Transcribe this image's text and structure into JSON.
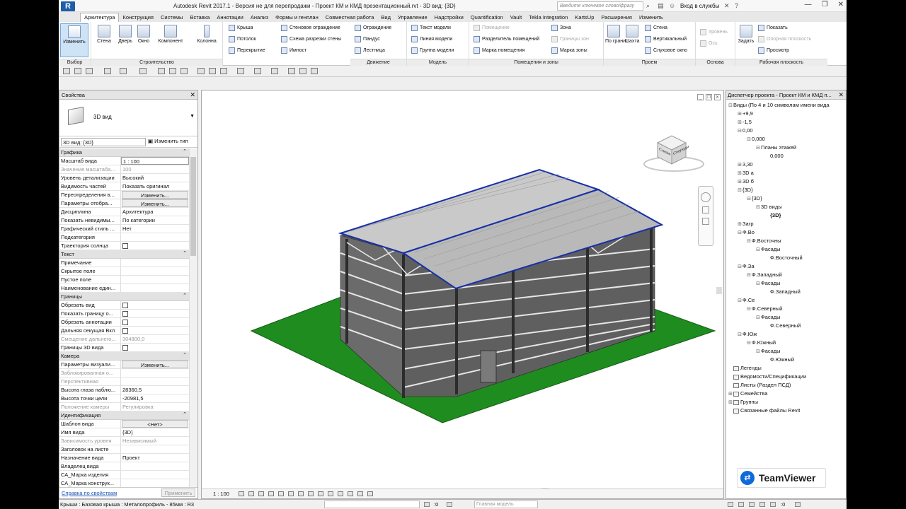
{
  "app": {
    "logo": "R",
    "title": "Autodesk Revit 2017.1 - Версия не для перепродажи -    Проект КМ и КМД презентационный.rvt - 3D вид: {3D}",
    "search_placeholder": "Введите ключевое слово/фразу",
    "login": "Вход в службы",
    "window_controls": [
      "—",
      "❐",
      "✕"
    ]
  },
  "ribbon_tabs": [
    "Архитектура",
    "Конструкция",
    "Системы",
    "Вставка",
    "Аннотации",
    "Анализ",
    "Формы и генплан",
    "Совместная работа",
    "Вид",
    "Управление",
    "Надстройки",
    "Quantification",
    "Vault",
    "Tekla Integration",
    "KartsUp",
    "Расширения",
    "Изменить"
  ],
  "ribbon": {
    "select_panel": "Выбор",
    "modify": "Изменить",
    "build_panel": "Строительство",
    "wall": "Стена",
    "door": "Дверь",
    "window": "Окно",
    "component": "Компонент",
    "column": "Колонна",
    "roof": "Крыша",
    "ceiling": "Потолок",
    "floor": "Перекрытие",
    "curtain_system": "Стеновое ограждение",
    "curtain_grid": "Схема разрезки стены",
    "mullion": "Импост",
    "circulation_panel": "Движение",
    "railing": "Ограждение",
    "ramp": "Пандус",
    "stair": "Лестница",
    "model_panel": "Модель",
    "model_text": "Текст модели",
    "model_line": "Линия модели",
    "model_group": "Группа модели",
    "rooms_panel": "Помещения и зоны",
    "room": "Помещение",
    "room_separator": "Разделитель помещений",
    "room_tag": "Марка помещения",
    "area": "Зона",
    "area_boundary": "Границы зон",
    "area_tag": "Марка зоны",
    "opening_panel": "Проем",
    "by_face": "По грани",
    "shaft": "Шахта",
    "wall_opening": "Стена",
    "vertical": "Вертикальный",
    "dormer": "Слуховое окно",
    "datum_panel": "Основа",
    "level": "Уровень",
    "grid": "Ось",
    "workplane_panel": "Рабочая плоскость",
    "set": "Задать",
    "show": "Показать",
    "ref_plane": "Опорная плоскость",
    "viewer": "Просмотр"
  },
  "properties": {
    "title": "Свойства",
    "type_name": "3D вид",
    "instance": "3D вид: {3D}",
    "edit_type": "Изменить тип",
    "sections": [
      {
        "name": "Графика",
        "rows": [
          {
            "k": "Масштаб вида",
            "v": "1 : 100",
            "kind": "input"
          },
          {
            "k": "Значение масштаба...",
            "v": "100",
            "kind": "dis"
          },
          {
            "k": "Уровень детализации",
            "v": "Высокий"
          },
          {
            "k": "Видимость частей",
            "v": "Показать оригинал"
          },
          {
            "k": "Переопределения в...",
            "v": "Изменить...",
            "kind": "btn"
          },
          {
            "k": "Параметры отобра...",
            "v": "Изменить...",
            "kind": "btn"
          },
          {
            "k": "Дисциплина",
            "v": "Архитектура"
          },
          {
            "k": "Показать невидимы...",
            "v": "По категории"
          },
          {
            "k": "Графический стиль ...",
            "v": "Нет"
          },
          {
            "k": "Подкатегория",
            "v": ""
          },
          {
            "k": "Траектория солнца",
            "v": "",
            "kind": "chk"
          }
        ]
      },
      {
        "name": "Текст",
        "rows": [
          {
            "k": "Примечание",
            "v": ""
          },
          {
            "k": "Скрытое поле",
            "v": ""
          },
          {
            "k": "Пустое поле",
            "v": ""
          },
          {
            "k": "Наименование един...",
            "v": ""
          }
        ]
      },
      {
        "name": "Границы",
        "rows": [
          {
            "k": "Обрезать вид",
            "v": "",
            "kind": "chk"
          },
          {
            "k": "Показать границу о...",
            "v": "",
            "kind": "chk"
          },
          {
            "k": "Обрезать аннотации",
            "v": "",
            "kind": "chk"
          },
          {
            "k": "Дальняя секущая Вкл",
            "v": "",
            "kind": "chk"
          },
          {
            "k": "Смещение дальнего...",
            "v": "304800,0",
            "kind": "dis"
          },
          {
            "k": "Границы 3D вида",
            "v": "",
            "kind": "chk"
          }
        ]
      },
      {
        "name": "Камера",
        "rows": [
          {
            "k": "Параметры визуали...",
            "v": "Изменить...",
            "kind": "btn"
          },
          {
            "k": "Заблокированная о...",
            "v": "",
            "kind": "dis"
          },
          {
            "k": "Перспективная",
            "v": "",
            "kind": "dis"
          },
          {
            "k": "Высота глаза наблю...",
            "v": "28360,5"
          },
          {
            "k": "Высота точки цели",
            "v": "-20981,5"
          },
          {
            "k": "Положение камеры",
            "v": "Регулировка",
            "kind": "dis"
          }
        ]
      },
      {
        "name": "Идентификация",
        "rows": [
          {
            "k": "Шаблон вида",
            "v": "<Нет>",
            "kind": "btn"
          },
          {
            "k": "Имя вида",
            "v": "{3D}"
          },
          {
            "k": "Зависимость уровня",
            "v": "Независимый",
            "kind": "dis"
          },
          {
            "k": "Заголовок на листе",
            "v": ""
          },
          {
            "k": "Назначение вида",
            "v": "Проект"
          },
          {
            "k": "Владелец вида",
            "v": ""
          },
          {
            "k": "СА_Марка изделия",
            "v": ""
          },
          {
            "k": "СА_Марка конструк...",
            "v": ""
          }
        ]
      }
    ],
    "help_link": "Справка по свойствам",
    "apply": "Применить"
  },
  "viewport": {
    "scale": "1 : 100",
    "viewcube_front": "Спереди",
    "viewcube_left": "Слева"
  },
  "browser": {
    "title": "Диспетчер проекта - Проект КМ и КМД п...",
    "nodes": [
      {
        "t": "Виды (По 4 и 10 символам имени вида",
        "d": 0,
        "e": "⊟"
      },
      {
        "t": "+9,9",
        "d": 1,
        "e": "⊞"
      },
      {
        "t": "-1,5",
        "d": 1,
        "e": "⊞"
      },
      {
        "t": "0,00",
        "d": 1,
        "e": "⊟"
      },
      {
        "t": "0,000",
        "d": 2,
        "e": "⊟"
      },
      {
        "t": "Планы этажей",
        "d": 3,
        "e": "⊟"
      },
      {
        "t": "0,000",
        "d": 4,
        "e": ""
      },
      {
        "t": "3,30",
        "d": 1,
        "e": "⊞"
      },
      {
        "t": "3D а",
        "d": 1,
        "e": "⊞"
      },
      {
        "t": "3D б",
        "d": 1,
        "e": "⊞"
      },
      {
        "t": "{3D}",
        "d": 1,
        "e": "⊟"
      },
      {
        "t": "{3D}",
        "d": 2,
        "e": "⊟"
      },
      {
        "t": "3D виды",
        "d": 3,
        "e": "⊟"
      },
      {
        "t": "{3D}",
        "d": 4,
        "e": "",
        "b": true
      },
      {
        "t": "Загр",
        "d": 1,
        "e": "⊞"
      },
      {
        "t": "Ф.Во",
        "d": 1,
        "e": "⊟"
      },
      {
        "t": "Ф.Восточны",
        "d": 2,
        "e": "⊟"
      },
      {
        "t": "Фасады",
        "d": 3,
        "e": "⊟"
      },
      {
        "t": "Ф.Восточный",
        "d": 4,
        "e": ""
      },
      {
        "t": "Ф.За",
        "d": 1,
        "e": "⊟"
      },
      {
        "t": "Ф.Западный",
        "d": 2,
        "e": "⊟"
      },
      {
        "t": "Фасады",
        "d": 3,
        "e": "⊟"
      },
      {
        "t": "Ф.Западный",
        "d": 4,
        "e": ""
      },
      {
        "t": "Ф.Се",
        "d": 1,
        "e": "⊟"
      },
      {
        "t": "Ф.Северный",
        "d": 2,
        "e": "⊟"
      },
      {
        "t": "Фасады",
        "d": 3,
        "e": "⊟"
      },
      {
        "t": "Ф.Северный",
        "d": 4,
        "e": ""
      },
      {
        "t": "Ф.Юж",
        "d": 1,
        "e": "⊟"
      },
      {
        "t": "Ф.Южный",
        "d": 2,
        "e": "⊟"
      },
      {
        "t": "Фасады",
        "d": 3,
        "e": "⊟"
      },
      {
        "t": "Ф.Южный",
        "d": 4,
        "e": ""
      },
      {
        "t": "Легенды",
        "d": 0,
        "e": "",
        "i": true
      },
      {
        "t": "Ведомости/Спецификации",
        "d": 0,
        "e": "",
        "i": true
      },
      {
        "t": "Листы (Раздел ПСД)",
        "d": 0,
        "e": "",
        "i": true
      },
      {
        "t": "Семейства",
        "d": 0,
        "e": "⊞",
        "i": true
      },
      {
        "t": "Группы",
        "d": 0,
        "e": "⊞",
        "i": true
      },
      {
        "t": "Связанные файлы Revit",
        "d": 0,
        "e": "",
        "i": true
      }
    ]
  },
  "teamviewer": "TeamViewer",
  "status": {
    "message": "Крыши : Базовая крыша : Металопрофиль - 85мм : R3",
    "model": "Главная модель",
    "zero": ":0"
  }
}
